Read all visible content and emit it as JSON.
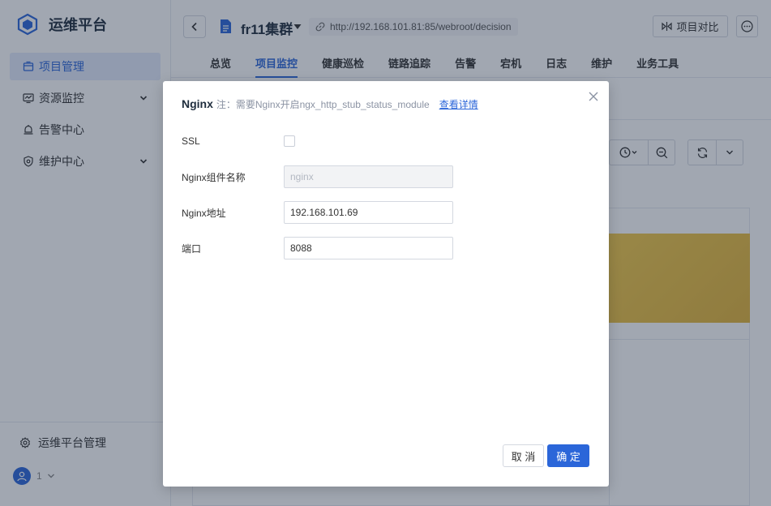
{
  "sidebar": {
    "brand_title": "运维平台",
    "items": [
      {
        "label": "项目管理",
        "icon": "project-icon",
        "active": true
      },
      {
        "label": "资源监控",
        "icon": "monitor-icon",
        "expandable": true
      },
      {
        "label": "告警中心",
        "icon": "alarm-icon"
      },
      {
        "label": "维护中心",
        "icon": "maintenance-icon",
        "expandable": true
      }
    ],
    "footer_link": "运维平台管理",
    "user_label": "1"
  },
  "topbar": {
    "project_name": "fr11集群",
    "url": "http://192.168.101.81:85/webroot/decision",
    "compare_label": "项目对比",
    "tabs": [
      {
        "label": "总览"
      },
      {
        "label": "项目监控",
        "active": true
      },
      {
        "label": "健康巡检"
      },
      {
        "label": "链路追踪"
      },
      {
        "label": "告警"
      },
      {
        "label": "宕机"
      },
      {
        "label": "日志"
      },
      {
        "label": "维护"
      },
      {
        "label": "业务工具"
      }
    ]
  },
  "modal": {
    "title": "Nginx",
    "note": "注：需要Nginx开启ngx_http_stub_status_module",
    "detail_link": "查看详情",
    "fields": {
      "ssl": {
        "label": "SSL",
        "checked": false
      },
      "component_name": {
        "label": "Nginx组件名称",
        "placeholder": "nginx",
        "value": ""
      },
      "address": {
        "label": "Nginx地址",
        "value": "192.168.101.69"
      },
      "port": {
        "label": "端口",
        "value": "8088"
      }
    },
    "cancel_label": "取 消",
    "ok_label": "确 定"
  },
  "colors": {
    "accent": "#2b66d9",
    "active_bg": "#e4ebfb",
    "banner": "#e8bc3f"
  }
}
